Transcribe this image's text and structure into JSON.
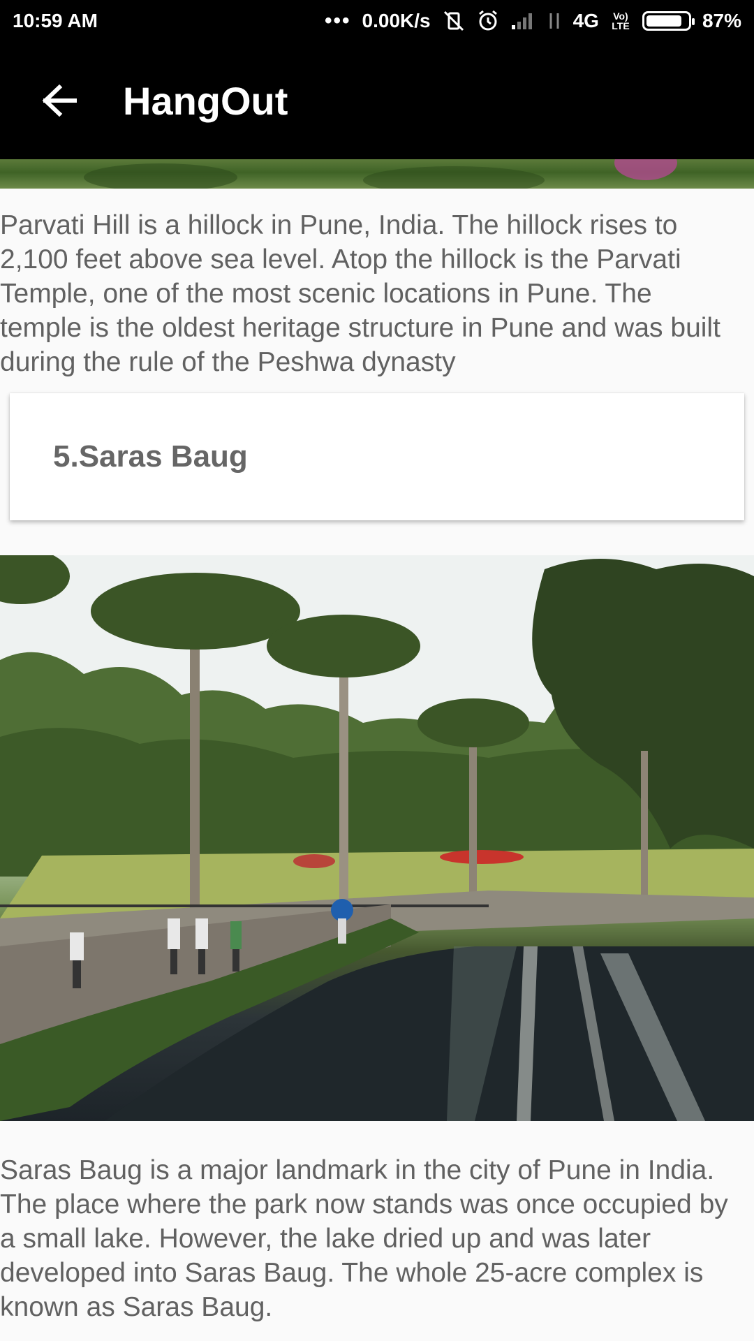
{
  "status_bar": {
    "time": "10:59 AM",
    "dots": "•••",
    "network_speed": "0.00K/s",
    "network_type": "4G",
    "volte": "Vo) LTE",
    "battery": "87%",
    "battery_level": 0.87
  },
  "app_bar": {
    "title": "HangOut"
  },
  "places": {
    "parvati_description": "Parvati Hill is a hillock in Pune, India. The hillock rises to 2,100 feet above sea level. Atop the hillock is the Parvati Temple, one of the most scenic locations in Pune. The temple is the oldest heritage structure in Pune and was built during the rule of the Peshwa dynasty",
    "saras_title": "5.Saras Baug",
    "saras_description": "Saras Baug is a major landmark in the city of Pune in India. The place where the park now stands was once occupied by a small lake. However, the lake dried up and was later developed into Saras Baug. The whole 25-acre complex is known as Saras Baug."
  },
  "colors": {
    "app_bar": "#000000",
    "text": "#616161",
    "background": "#fafafa"
  }
}
